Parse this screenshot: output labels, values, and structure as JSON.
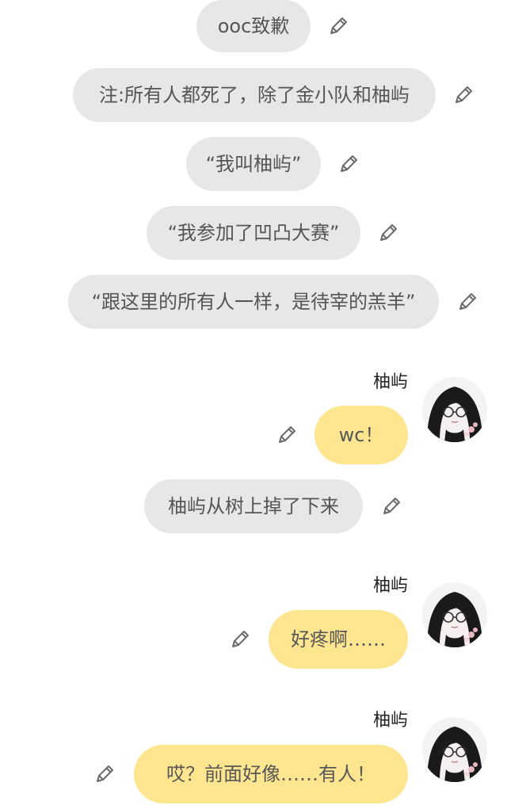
{
  "colors": {
    "narration_bubble": "#e7e7e7",
    "speech_bubble": "#fde68f",
    "bubble_text": "#555555",
    "name_text": "#222222"
  },
  "icons": {
    "edit": "pencil-icon",
    "avatar": "character-avatar"
  },
  "messages": [
    {
      "type": "narration",
      "text": "ooc致歉"
    },
    {
      "type": "narration",
      "text": "注:所有人都死了，除了金小队和柚屿"
    },
    {
      "type": "narration",
      "text": "“我叫柚屿”"
    },
    {
      "type": "narration",
      "text": "“我参加了凹凸大赛”"
    },
    {
      "type": "narration",
      "text": "“跟这里的所有人一样，是待宰的羔羊”"
    },
    {
      "type": "speech",
      "speaker": "柚屿",
      "text": "wc！"
    },
    {
      "type": "narration",
      "text": "柚屿从树上掉了下来"
    },
    {
      "type": "speech",
      "speaker": "柚屿",
      "text": "好疼啊……"
    },
    {
      "type": "speech",
      "speaker": "柚屿",
      "text": "哎？前面好像……有人！"
    }
  ]
}
